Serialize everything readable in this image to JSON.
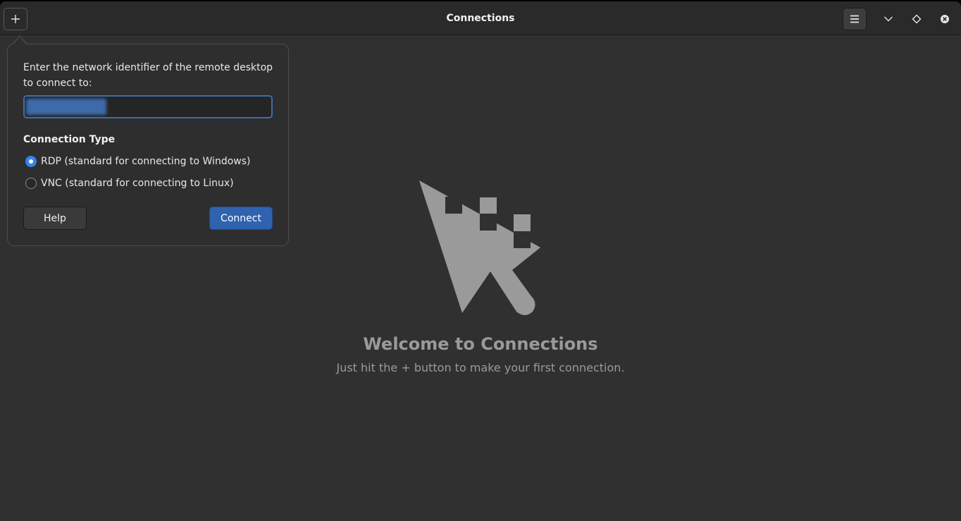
{
  "window": {
    "title": "Connections"
  },
  "headerbar": {
    "add_button_icon": "plus-icon",
    "menu_button_icon": "hamburger-menu-icon",
    "minimize_icon": "chevron-down-icon",
    "maximize_icon": "diamond-icon",
    "close_icon": "close-circle-icon"
  },
  "popover": {
    "prompt": "Enter the network identifier of the remote desktop to connect to:",
    "host_value": "",
    "host_value_note": "blurred/selected text",
    "connection_type_label": "Connection Type",
    "options": [
      {
        "label": "RDP (standard for connecting to Windows)",
        "selected": true
      },
      {
        "label": "VNC (standard for connecting to Linux)",
        "selected": false
      }
    ],
    "help_label": "Help",
    "connect_label": "Connect"
  },
  "welcome": {
    "icon": "remote-cursor-icon",
    "title": "Welcome to Connections",
    "subtitle": "Just hit the + button to make your first connection."
  },
  "colors": {
    "background": "#303030",
    "headerbar": "#2a2a2a",
    "accent": "#3584e4",
    "connect_button": "#2f63b0",
    "welcome_text": "#9a9a9a"
  }
}
